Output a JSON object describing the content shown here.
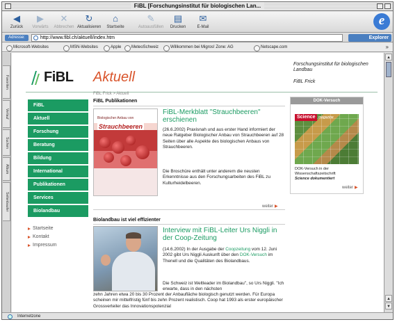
{
  "window": {
    "title": "FiBL [Forschungsinstitut für biologischen Lan..."
  },
  "toolbar": {
    "buttons": [
      {
        "label": "Zurück",
        "icon": "back-arrow-icon"
      },
      {
        "label": "Vorwärts",
        "icon": "forward-arrow-icon"
      },
      {
        "label": "Abbrechen",
        "icon": "stop-icon"
      },
      {
        "label": "Aktualisieren",
        "icon": "refresh-icon"
      },
      {
        "label": "Startseite",
        "icon": "home-icon"
      },
      {
        "label": "Autoausfüllen",
        "icon": "autofill-icon"
      },
      {
        "label": "Drucken",
        "icon": "print-icon"
      },
      {
        "label": "E-Mail",
        "icon": "mail-icon"
      }
    ]
  },
  "address": {
    "label": "Adresse:",
    "url": "http://www.fibl.ch/aktuell/index.htm",
    "explorer_label": "Explorer"
  },
  "favorites": [
    "Microsoft-Websites",
    "MSN-Websites",
    "Apple",
    "MeteoSchweiz",
    "Willkommen bei Migros! Zone: AG",
    "Netscape.com"
  ],
  "side_tabs": [
    "Favoriten",
    "Verlauf",
    "Suchen",
    "Album",
    "Seitenbaufer"
  ],
  "status": {
    "text": "Internetzone"
  },
  "page": {
    "logo_text": "FiBL",
    "title": "Aktuell",
    "institute_line1": "Forschungsinstitut für biologischen Landbau",
    "institute_line2": "FiBL Frick",
    "breadcrumb": "FiBL Frick > Aktuell",
    "nav": [
      "FiBL",
      "Aktuell",
      "Forschung",
      "Beratung",
      "Bildung",
      "International",
      "Publikationen",
      "Services",
      "Biolandbau"
    ],
    "sublinks": [
      "Startseite",
      "Kontakt",
      "Impressum"
    ],
    "section1_title": "FiBL Publikationen",
    "book": {
      "small_text": "Biologischer Anbau von",
      "title": "Strauchbeeren"
    },
    "article1": {
      "title": "FiBL-Merkblatt \"Strauchbeeren\" erschienen",
      "p1": "(26.6.2002) Praxisnah und aus erster Hand informiert der neue Ratgeber Biologischer Anbau von Strauchbeeren auf 28 Seiten über alle Aspekte des biologischen Anbaus von Strauchbeeren.",
      "p2": "Die Broschüre enthält unter anderem die neusten Erkenntnisse aus den Forschungsarbeiten des FiBL zu Kulturheidelbeeren.",
      "more": "weiter"
    },
    "section2_title": "Biolandbau ist viel effizienter",
    "article2": {
      "title": "Interview mit FiBL-Leiter Urs Niggli in der Coop-Zeitung",
      "p1_a": "(14.6.2002) In der Ausgabe der ",
      "p1_link": "Coopzeitung",
      "p1_b": " vom 12. Juni 2002 gibt Urs Niggli Auskunft über den ",
      "p1_link2": "DOK-Versuch",
      "p1_c": " im Thenell und die Qualitäten des Biolandbaus.",
      "p2": "Die Schweiz ist Weltleader im Biolandbau\", so Urs Niggli. \"Ich erwarte, dass in den nächsten",
      "p3": "zehn Jahren etwa 20 bis 30 Prozent der Anbaufläche biologisch genutzt werden. Für Europa scheinen mir mittelfristig fünf bis zehn Prozent realistisch. Coop hat 1993 als erster europäischer Grossverteiler das Innovationspotenzial"
    },
    "sidebox": {
      "heading": "DOK-Versuch",
      "science_label": "Science",
      "science_magazine": "magazine",
      "caption1": "DOK-Versuch in der Wissenschaftszeitschrift",
      "caption2": "Science dokumentiert",
      "more": "weiter"
    }
  }
}
